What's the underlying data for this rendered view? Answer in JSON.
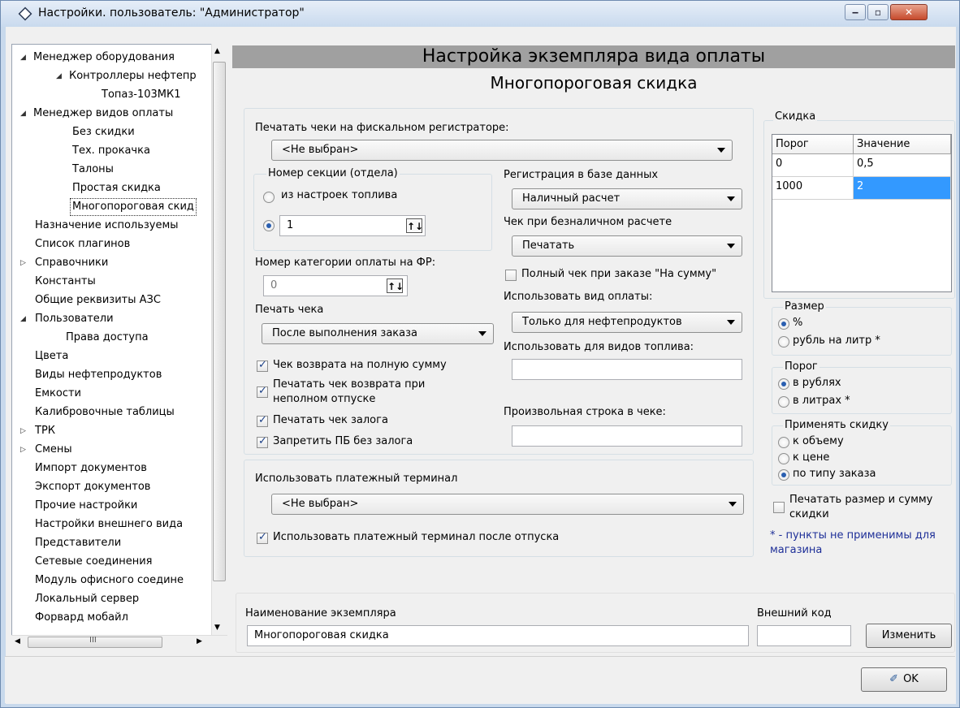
{
  "window": {
    "title": "Настройки. пользователь: \"Администратор\"",
    "min_glyph": "‒",
    "max_glyph": "▫",
    "close_glyph": "✕"
  },
  "tree": {
    "items": [
      {
        "label": "Менеджер оборудования",
        "expander": "◢"
      },
      {
        "label": "Контроллеры нефтепр",
        "expander": "◢"
      },
      {
        "label": "Топаз-103МК1"
      },
      {
        "label": "Менеджер видов оплаты",
        "expander": "◢"
      },
      {
        "label": "Без скидки"
      },
      {
        "label": "Тех. прокачка"
      },
      {
        "label": "Талоны"
      },
      {
        "label": "Простая скидка"
      },
      {
        "label": "Многопороговая скид"
      },
      {
        "label": "Назначение используемы"
      },
      {
        "label": "Список плагинов"
      },
      {
        "label": "Справочники",
        "expander": "▷"
      },
      {
        "label": "Константы"
      },
      {
        "label": "Общие реквизиты АЗС"
      },
      {
        "label": "Пользователи",
        "expander": "◢"
      },
      {
        "label": "Права доступа"
      },
      {
        "label": "Цвета"
      },
      {
        "label": "Виды нефтепродуктов"
      },
      {
        "label": "Емкости"
      },
      {
        "label": "Калибровочные таблицы"
      },
      {
        "label": "ТРК",
        "expander": "▷"
      },
      {
        "label": "Смены",
        "expander": "▷"
      },
      {
        "label": "Импорт документов"
      },
      {
        "label": "Экспорт документов"
      },
      {
        "label": "Прочие настройки"
      },
      {
        "label": "Настройки внешнего вида"
      },
      {
        "label": "Представители"
      },
      {
        "label": "Сетевые соединения"
      },
      {
        "label": "Модуль офисного соедине"
      },
      {
        "label": "Локальный сервер"
      },
      {
        "label": "Форвард мобайл"
      }
    ],
    "scroll_up": "▲",
    "scroll_down": "▼",
    "scroll_left": "◀",
    "scroll_right": "▶",
    "grip": "III"
  },
  "header": {
    "title": "Настройка экземпляра вида оплаты",
    "subtitle": "Многопороговая скидка"
  },
  "fiscal": {
    "label": "Печатать чеки на фискальном регистраторе:",
    "value": "<Не выбран>"
  },
  "section": {
    "label": "Номер секции (отдела)",
    "radio_fuel": "из настроек топлива",
    "number_value": "1",
    "spin_glyph": "↑↓"
  },
  "category": {
    "label": "Номер категории оплаты на ФР:",
    "value": "0"
  },
  "print_check": {
    "label": "Печать чека",
    "value": "После выполнения заказа"
  },
  "checkboxes": {
    "return_full": "Чек возврата на полную сумму",
    "return_partial_1": "Печатать чек возврата при",
    "return_partial_2": "неполном отпуске",
    "deposit_check": "Печатать чек залога",
    "forbid_pb": "Запретить ПБ без залога"
  },
  "registration": {
    "label": "Регистрация в базе данных",
    "value": "Наличный расчет"
  },
  "cashless": {
    "label": "Чек при безналичном расчете",
    "value": "Печатать"
  },
  "full_check": "Полный чек при заказе \"На сумму\"",
  "use_payment": {
    "label": "Использовать вид оплаты:",
    "value": "Только для нефтепродуктов"
  },
  "fuel_types": {
    "label": "Использовать для видов топлива:",
    "value": ""
  },
  "free_line": {
    "label": "Произвольная строка в чеке:",
    "value": ""
  },
  "terminal": {
    "label": "Использовать платежный терминал",
    "value": "<Не выбран>",
    "after_label": "Использовать платежный терминал после отпуска"
  },
  "discount": {
    "label": "Скидка",
    "columns": [
      "Порог",
      "Значение"
    ],
    "rows": [
      [
        "0",
        "0,5"
      ],
      [
        "1000",
        "2"
      ]
    ]
  },
  "size": {
    "label": "Размер",
    "percent": "%",
    "rub_liter": "рубль на литр *"
  },
  "threshold": {
    "label": "Порог",
    "rubles": "в рублях",
    "liters": "в литрах *"
  },
  "apply": {
    "label": "Применять скидку",
    "volume": "к объему",
    "price": "к цене",
    "order_type": "по типу заказа"
  },
  "print_size": {
    "line1": "Печатать размер и сумму",
    "line2": "скидки"
  },
  "note": {
    "line1": "* - пункты не применимы для",
    "line2": "магазина"
  },
  "instance": {
    "label": "Наименование экземпляра",
    "value": "Многопороговая скидка"
  },
  "external": {
    "label": "Внешний код",
    "value": ""
  },
  "buttons": {
    "change": "Изменить",
    "ok": "OK",
    "ok_icon": "✐"
  }
}
